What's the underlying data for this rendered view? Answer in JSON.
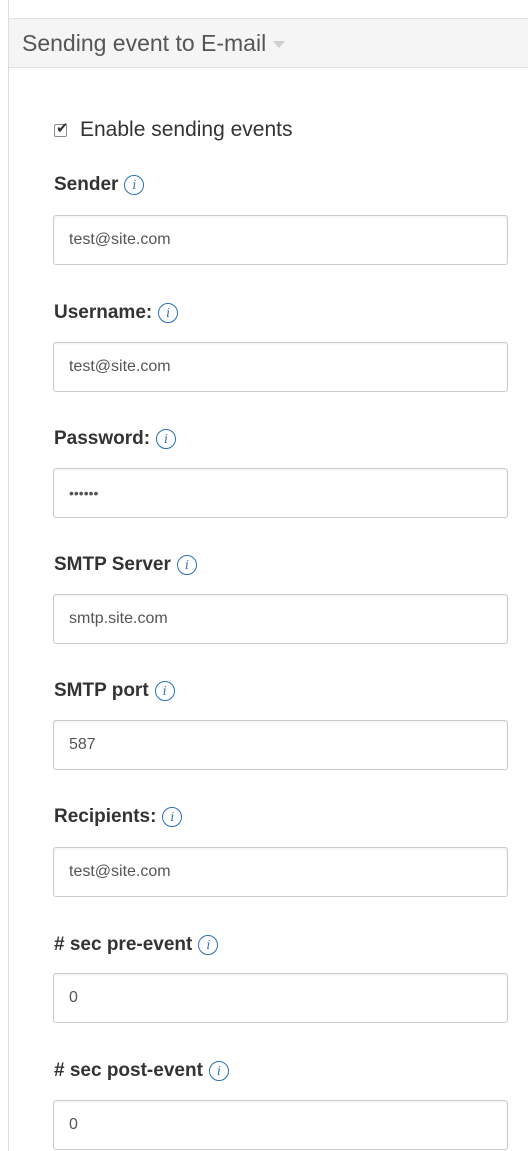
{
  "header": {
    "title": "Sending event to E-mail"
  },
  "enable": {
    "label": "Enable sending events",
    "checked": true,
    "mark": "✔"
  },
  "info_glyph": "i",
  "fields": {
    "sender": {
      "label": "Sender",
      "value": "test@site.com"
    },
    "username": {
      "label": "Username:",
      "value": "test@site.com"
    },
    "password": {
      "label": "Password:",
      "value": "••••••"
    },
    "smtp_server": {
      "label": "SMTP Server",
      "value": "smtp.site.com"
    },
    "smtp_port": {
      "label": "SMTP port",
      "value": "587"
    },
    "recipients": {
      "label": "Recipients:",
      "value": "test@site.com"
    },
    "pre_event": {
      "label": "# sec pre-event",
      "value": "0"
    },
    "post_event": {
      "label": "# sec post-event",
      "value": "0"
    }
  },
  "colors": {
    "info_icon": "#2a6ebb",
    "header_bg": "#f5f5f5",
    "text": "#333333"
  },
  "icons": {
    "header": "chevron-down-icon",
    "info": "info-icon",
    "checkbox": "checkmark-icon"
  }
}
